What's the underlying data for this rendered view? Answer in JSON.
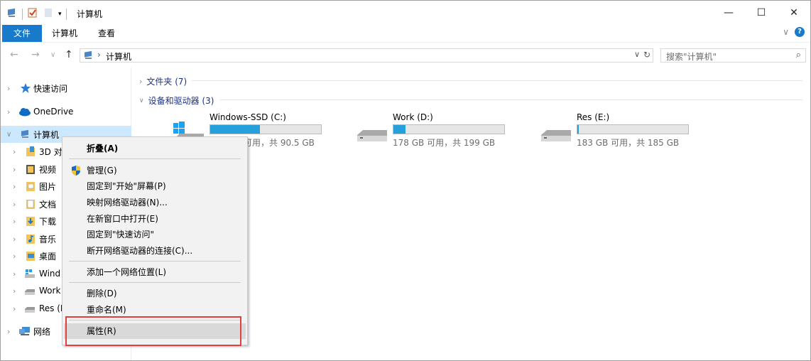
{
  "window": {
    "title": "计算机",
    "controls": {
      "minimize": "—",
      "maximize": "☐",
      "close": "✕"
    }
  },
  "ribbon": {
    "tabs": [
      "文件",
      "计算机",
      "查看"
    ],
    "expand": "∨",
    "help": "?"
  },
  "address": {
    "back": "←",
    "forward": "→",
    "recent": "∨",
    "up": "↑",
    "path": "计算机",
    "dropdown": "∨",
    "refresh": "↻"
  },
  "search": {
    "placeholder": "搜索\"计算机\"",
    "icon": "search-icon"
  },
  "nav": {
    "top": [
      {
        "label": "快速访问",
        "icon": "star-icon"
      },
      {
        "label": "OneDrive",
        "icon": "cloud-icon"
      },
      {
        "label": "计算机",
        "icon": "computer-icon"
      }
    ],
    "children": [
      {
        "label": "3D 对",
        "icon": "3d-objects-icon"
      },
      {
        "label": "视频",
        "icon": "video-folder-icon"
      },
      {
        "label": "图片",
        "icon": "pictures-folder-icon"
      },
      {
        "label": "文档",
        "icon": "documents-folder-icon"
      },
      {
        "label": "下载",
        "icon": "downloads-folder-icon"
      },
      {
        "label": "音乐",
        "icon": "music-folder-icon"
      },
      {
        "label": "桌面",
        "icon": "desktop-folder-icon"
      },
      {
        "label": "Wind",
        "icon": "windows-drive-icon"
      },
      {
        "label": "Work",
        "icon": "drive-icon"
      },
      {
        "label": "Res (E",
        "icon": "drive-icon"
      }
    ],
    "network": {
      "label": "网络",
      "icon": "network-icon"
    }
  },
  "content": {
    "groups": [
      {
        "label": "文件夹 (7)",
        "expanded": false
      },
      {
        "label": "设备和驱动器 (3)",
        "expanded": true
      }
    ],
    "drives": [
      {
        "name": "Windows-SSD (C:)",
        "info": "可用，共 90.5 GB",
        "used_fraction": 0.45,
        "icon": "windows-drive-icon"
      },
      {
        "name": "Work (D:)",
        "info": "178 GB 可用，共 199 GB",
        "used_fraction": 0.11,
        "icon": "drive-icon"
      },
      {
        "name": "Res (E:)",
        "info": "183 GB 可用，共 185 GB",
        "used_fraction": 0.01,
        "icon": "drive-icon"
      }
    ]
  },
  "context_menu": {
    "items": [
      {
        "label": "折叠(A)",
        "bold": true
      },
      {
        "label": "管理(G)",
        "icon": "shield-icon"
      },
      {
        "label": "固定到\"开始\"屏幕(P)"
      },
      {
        "label": "映射网络驱动器(N)..."
      },
      {
        "label": "在新窗口中打开(E)"
      },
      {
        "label": "固定到\"快速访问\""
      },
      {
        "label": "断开网络驱动器的连接(C)..."
      },
      {
        "label": "添加一个网络位置(L)"
      },
      {
        "label": "删除(D)"
      },
      {
        "label": "重命名(M)"
      },
      {
        "label": "属性(R)",
        "highlighted": true
      }
    ]
  },
  "colors": {
    "accent": "#1979ca",
    "selection": "#cce8ff",
    "bar_fill": "#26a0da",
    "highlight_box": "#e04040"
  }
}
